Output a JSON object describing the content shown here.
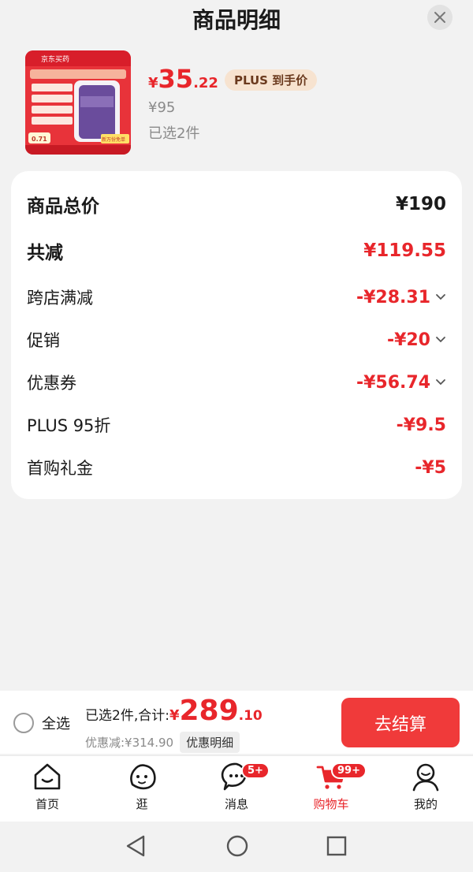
{
  "header": {
    "title": "商品明细"
  },
  "product": {
    "price_symbol": "¥",
    "price_int": "35",
    "price_dec": ".22",
    "plus_badge": "PLUS 到手价",
    "original_price": "¥95",
    "selected": "已选2件",
    "thumb_texts": [
      "京东买药",
      "0.71",
      "新万份免单"
    ]
  },
  "summary": {
    "rows": [
      {
        "label": "商品总价",
        "value": "¥190"
      },
      {
        "label": "共减",
        "value": "¥119.55"
      },
      {
        "label": "跨店满减",
        "value": "-¥28.31"
      },
      {
        "label": "促销",
        "value": "-¥20"
      },
      {
        "label": "优惠券",
        "value": "-¥56.74"
      },
      {
        "label": "PLUS 95折",
        "value": "-¥9.5"
      },
      {
        "label": "首购礼金",
        "value": "-¥5"
      }
    ]
  },
  "checkout": {
    "select_all": "全选",
    "total_label": "已选2件,合计:",
    "total_symbol": "¥",
    "total_int": "289",
    "total_dec": ".10",
    "discount_text": "优惠减:¥314.90",
    "detail_button": "优惠明细",
    "checkout_button": "去结算"
  },
  "tabbar": {
    "tabs": [
      {
        "label": "首页",
        "icon": "home-icon"
      },
      {
        "label": "逛",
        "icon": "stroll-icon"
      },
      {
        "label": "消息",
        "icon": "message-icon",
        "badge": "5+"
      },
      {
        "label": "购物车",
        "icon": "cart-icon",
        "badge": "99+"
      },
      {
        "label": "我的",
        "icon": "profile-icon"
      }
    ]
  },
  "colors": {
    "accent": "#e8262b",
    "checkout_button": "#f03a3a",
    "plus_badge_bg": "#f7e3d0"
  }
}
